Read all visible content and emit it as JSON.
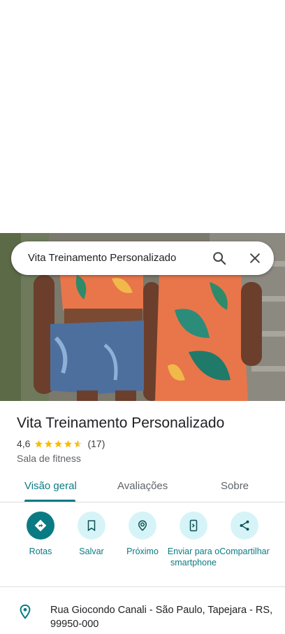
{
  "search": {
    "query": "Vita Treinamento Personalizado"
  },
  "place": {
    "title": "Vita Treinamento Personalizado",
    "rating": "4,6",
    "rating_value": 4.6,
    "reviews": "(17)",
    "category": "Sala de fitness"
  },
  "tabs": [
    {
      "label": "Visão geral",
      "active": true
    },
    {
      "label": "Avaliações",
      "active": false
    },
    {
      "label": "Sobre",
      "active": false
    }
  ],
  "actions": [
    {
      "label": "Rotas",
      "icon": "directions-icon"
    },
    {
      "label": "Salvar",
      "icon": "bookmark-icon"
    },
    {
      "label": "Próximo",
      "icon": "nearby-icon"
    },
    {
      "label": "Enviar para o smartphone",
      "icon": "send-to-phone-icon"
    },
    {
      "label": "Compartilhar",
      "icon": "share-icon"
    }
  ],
  "address": "Rua Giocondo Canali - São Paulo, Tapejara - RS, 99950-000",
  "colors": {
    "accent": "#0a7b83",
    "action_bg": "#d6f4f7",
    "star": "#fbbc04"
  }
}
